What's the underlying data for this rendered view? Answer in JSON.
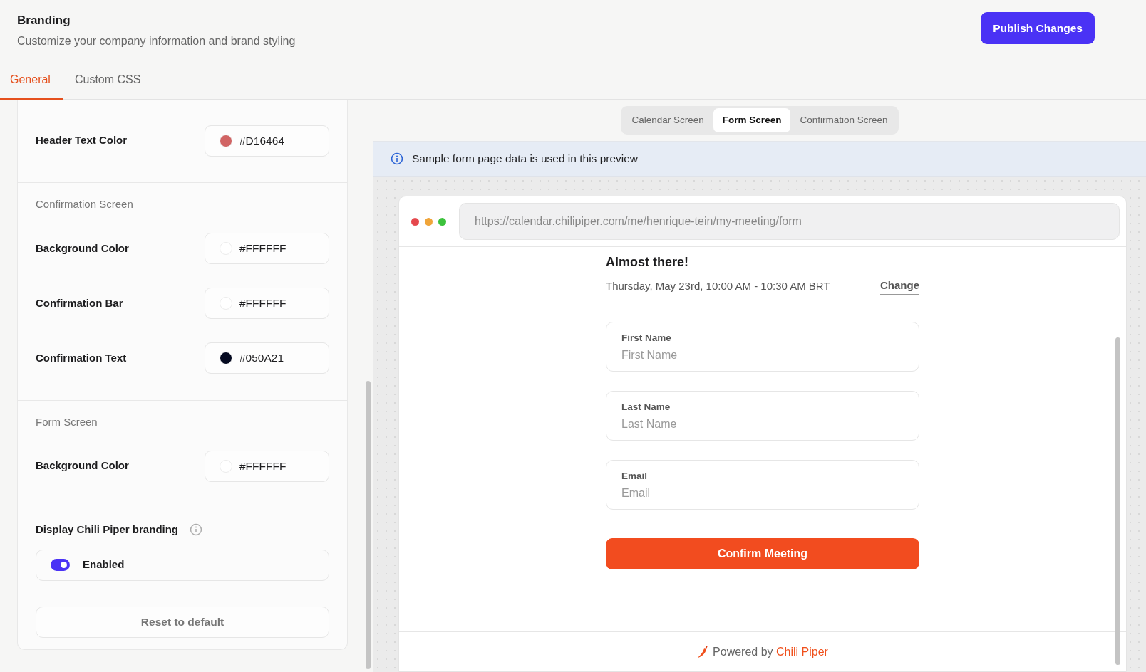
{
  "header": {
    "title": "Branding",
    "subtitle": "Customize your company information and brand styling"
  },
  "publish_button": "Publish Changes",
  "tabs": [
    {
      "label": "General",
      "selected": true
    },
    {
      "label": "Custom CSS",
      "selected": false
    }
  ],
  "settings": {
    "sections": [
      {
        "rows": [
          {
            "label": "Header Text Color",
            "value": "#D16464",
            "color": "#d16464"
          }
        ]
      },
      {
        "heading": "Confirmation Screen",
        "rows": [
          {
            "label": "Background Color",
            "value": "#FFFFFF",
            "color": "#ffffff"
          },
          {
            "label": "Confirmation Bar",
            "value": "#FFFFFF",
            "color": "#ffffff"
          },
          {
            "label": "Confirmation Text",
            "value": "#050A21",
            "color": "#050a21"
          }
        ]
      },
      {
        "heading": "Form Screen",
        "rows": [
          {
            "label": "Background Color",
            "value": "#FFFFFF",
            "color": "#ffffff"
          }
        ]
      }
    ],
    "branding": {
      "label": "Display Chili Piper branding",
      "toggle": {
        "label": "Enabled",
        "on": true
      }
    },
    "reset_button": "Reset to default"
  },
  "preview": {
    "screen_tabs": [
      {
        "label": "Calendar Screen",
        "selected": false
      },
      {
        "label": "Form Screen",
        "selected": true
      },
      {
        "label": "Confirmation Screen",
        "selected": false
      }
    ],
    "notice": "Sample form page data is used in this preview",
    "url": "https://calendar.chilipiper.com/me/henrique-tein/my-meeting/form",
    "form": {
      "title": "Almost there!",
      "datetime": "Thursday, May 23rd, 10:00 AM - 10:30 AM BRT",
      "change_link": "Change",
      "fields": [
        {
          "label": "First Name",
          "placeholder": "First Name"
        },
        {
          "label": "Last Name",
          "placeholder": "Last Name"
        },
        {
          "label": "Email",
          "placeholder": "Email"
        }
      ],
      "confirm_button": "Confirm Meeting"
    },
    "footer": {
      "powered_by": "Powered by",
      "brand": "Chili Piper"
    }
  }
}
